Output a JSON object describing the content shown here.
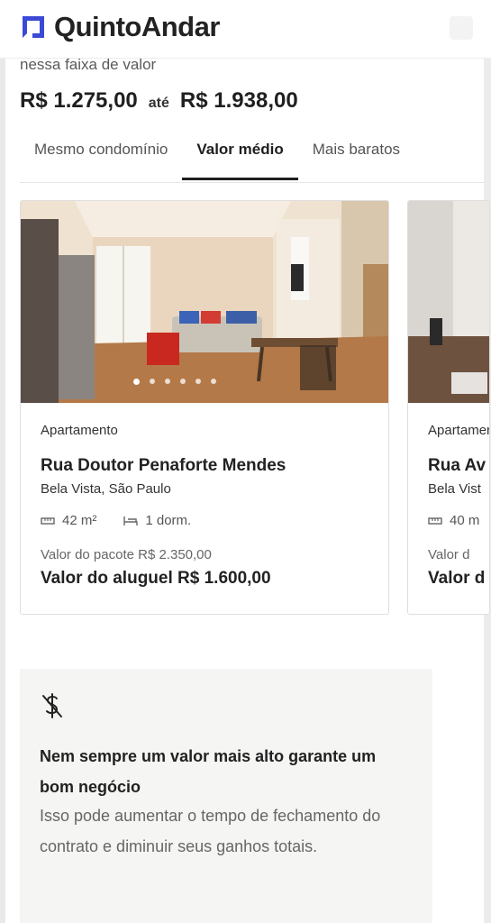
{
  "header": {
    "brand": "QuintoAndar"
  },
  "range": {
    "subtitle": "nessa faixa de valor",
    "min_price": "R$ 1.275,00",
    "separator": "até",
    "max_price": "R$ 1.938,00"
  },
  "tabs": [
    {
      "label": "Mesmo condomínio",
      "active": false
    },
    {
      "label": "Valor médio",
      "active": true
    },
    {
      "label": "Mais baratos",
      "active": false
    }
  ],
  "listings": [
    {
      "type": "Apartamento",
      "street": "Rua Doutor Penaforte Mendes",
      "neighborhood": "Bela Vista, São Paulo",
      "area": "42 m²",
      "bedrooms": "1 dorm.",
      "package": "Valor do pacote R$ 2.350,00",
      "rent": "Valor do aluguel R$ 1.600,00",
      "photo_count": 6,
      "current_photo": 1
    },
    {
      "type": "Apartamento",
      "street": "Rua Av",
      "neighborhood": "Bela Vist",
      "area": "40 m",
      "package": "Valor d",
      "rent": "Valor d"
    }
  ],
  "info": {
    "icon": "no-dollar-icon",
    "title": "Nem sempre um valor mais alto garante um bom negócio",
    "body": "Isso pode aumentar o tempo de fechamento do contrato e diminuir seus ganhos totais."
  },
  "colors": {
    "brand": "#3b4ad6",
    "text": "#1f1f1f",
    "info_bg": "#f5f5f3"
  }
}
